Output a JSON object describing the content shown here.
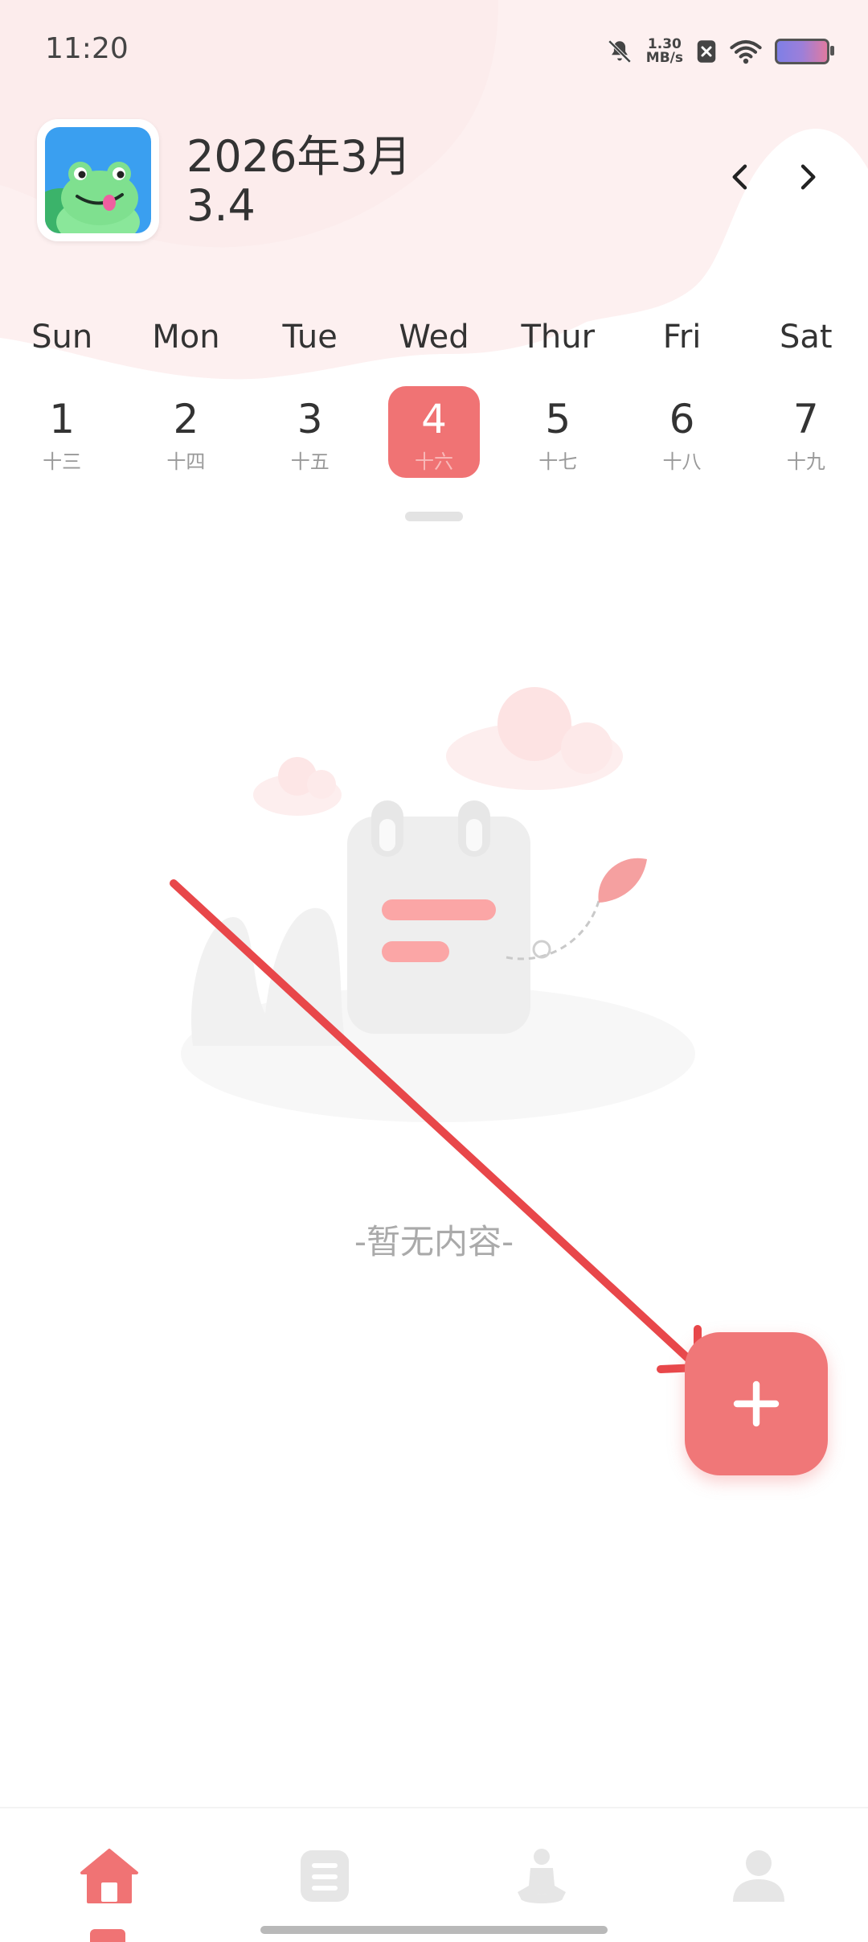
{
  "status_bar": {
    "time": "11:20",
    "net_speed_value": "1.30",
    "net_speed_unit": "MB/s",
    "icons": [
      "mute-icon",
      "no-sim-icon",
      "wifi-icon",
      "battery-icon"
    ]
  },
  "header": {
    "month_title": "2026年3月",
    "selected_date": "3.4",
    "avatar_icon": "frog-avatar-icon",
    "prev_icon": "chevron-left-icon",
    "next_icon": "chevron-right-icon"
  },
  "week": {
    "weekdays": [
      "Sun",
      "Mon",
      "Tue",
      "Wed",
      "Thur",
      "Fri",
      "Sat"
    ],
    "days": [
      {
        "num": "1",
        "lunar": "十三"
      },
      {
        "num": "2",
        "lunar": "十四"
      },
      {
        "num": "3",
        "lunar": "十五"
      },
      {
        "num": "4",
        "lunar": "十六"
      },
      {
        "num": "5",
        "lunar": "十七"
      },
      {
        "num": "6",
        "lunar": "十八"
      },
      {
        "num": "7",
        "lunar": "十九"
      }
    ],
    "selected_index": 3
  },
  "empty_state": {
    "text": "-暂无内容-",
    "illustration_icon": "empty-calendar-illustration"
  },
  "fab": {
    "icon": "plus-icon"
  },
  "bottom_nav": {
    "items": [
      "home-icon",
      "list-icon",
      "meditation-icon",
      "user-icon"
    ],
    "active_index": 0
  },
  "colors": {
    "accent": "#f07374",
    "header_bg": "#fdf0f0",
    "annotation_arrow": "#e8474a"
  }
}
